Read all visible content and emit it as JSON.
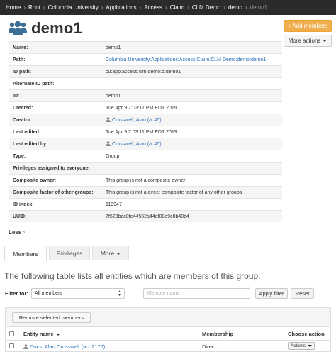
{
  "breadcrumb": [
    {
      "label": "Home"
    },
    {
      "label": "Root"
    },
    {
      "label": "Columbia University"
    },
    {
      "label": "Applications"
    },
    {
      "label": "Access"
    },
    {
      "label": "Claim"
    },
    {
      "label": "CLM Demo"
    },
    {
      "label": "demo"
    },
    {
      "label": "demo1"
    }
  ],
  "header": {
    "title": "demo1",
    "add_members_label": "+ Add members",
    "more_actions_label": "More actions"
  },
  "details": [
    {
      "label": "Name:",
      "value": ""
    },
    {
      "label": "Path:",
      "value": "Columbia University:Applications:Access:Claim:CLM Demo:demo:demo1"
    },
    {
      "label": "ID path:",
      "value": "cu:app:access:clm:demo:d:demo1"
    },
    {
      "label": "Alternate ID path:",
      "value": ""
    },
    {
      "label": "ID:",
      "value": "demo1"
    },
    {
      "label": "Created:",
      "value": "Tue Apr 9 7:03:11 PM EDT 2019"
    },
    {
      "label": "Creator:",
      "value": "Crosswell, Alan (ac45)",
      "user": true
    },
    {
      "label": "Last edited:",
      "value": "Tue Apr 9 7:03:11 PM EDT 2019"
    },
    {
      "label": "Last edited by:",
      "value": "Crosswell, Alan (ac45)",
      "user": true
    },
    {
      "label": "Type:",
      "value": "Group"
    },
    {
      "label": "Privileges assigned to everyone:",
      "value": ""
    },
    {
      "label": "Composite owner:",
      "value": "This group is not a composite owner"
    },
    {
      "label": "Composite factor of other groups:",
      "value": "This group is not a direct composite factor of any other groups"
    },
    {
      "label": "ID index:",
      "value": "119947"
    },
    {
      "label": "UUID:",
      "value": "7f528bac0fe44562a44df00e9c8b40b4"
    }
  ],
  "name_value": "demo1",
  "less_label": "Less",
  "tabs": [
    {
      "label": "Members"
    },
    {
      "label": "Privileges"
    },
    {
      "label": "More"
    }
  ],
  "intro_text": "The following table lists all entities which are members of this group.",
  "filter": {
    "label": "Filter for:",
    "selected": "All members",
    "search_placeholder": "Member name",
    "apply_label": "Apply filter",
    "reset_label": "Reset"
  },
  "table": {
    "remove_label": "Remove selected members",
    "columns": {
      "entity_name": "Entity name",
      "membership": "Membership",
      "choose_action": "Choose action"
    },
    "rows": [
      {
        "entity": "Docs, Alan Crosswell (acd2175)",
        "membership": "Direct",
        "action_label": "Actions"
      }
    ]
  },
  "colors": {
    "breadcrumb_bg": "#2b2b2b",
    "accent_orange": "#f0ad4e",
    "link_blue": "#2a6fb5"
  }
}
